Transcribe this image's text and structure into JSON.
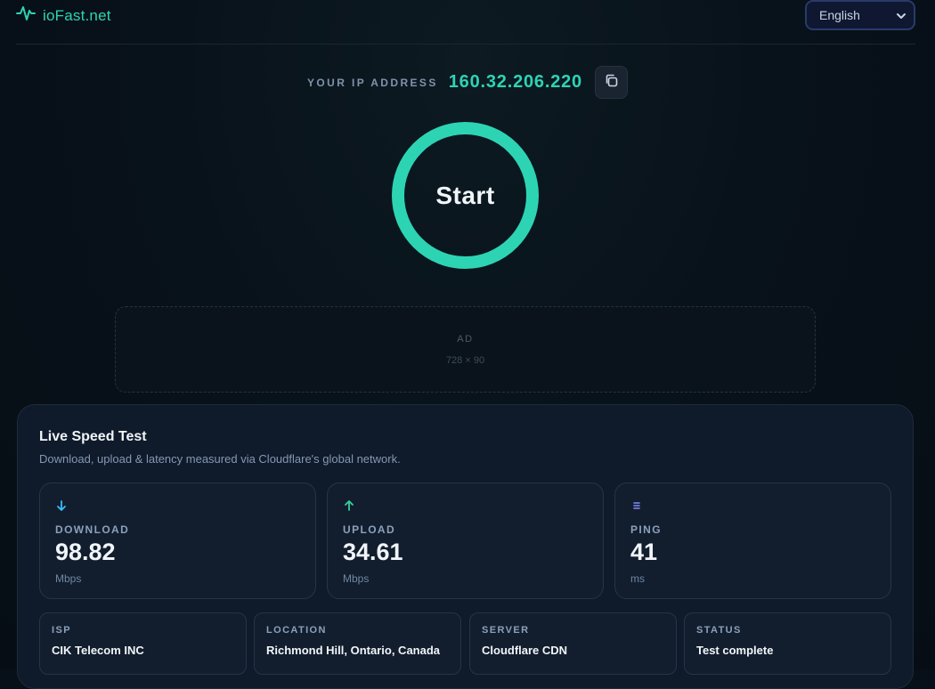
{
  "brand": {
    "name": "ioFast.net"
  },
  "language": {
    "selected": "English"
  },
  "ip": {
    "label": "YOUR IP ADDRESS",
    "value": "160.32.206.220"
  },
  "start_button": {
    "label": "Start"
  },
  "ad": {
    "label": "AD",
    "size": "728 × 90"
  },
  "panel": {
    "title": "Live Speed Test",
    "subtitle": "Download, upload & latency measured via Cloudflare's global network.",
    "metrics": [
      {
        "icon": "arrow-down-icon",
        "label": "DOWNLOAD",
        "value": "98.82",
        "unit": "Mbps",
        "color": "#38bdf8"
      },
      {
        "icon": "arrow-up-icon",
        "label": "UPLOAD",
        "value": "34.61",
        "unit": "Mbps",
        "color": "#34d399"
      },
      {
        "icon": "ping-icon",
        "label": "PING",
        "value": "41",
        "unit": "ms",
        "color": "#818cf8"
      }
    ],
    "info": [
      {
        "label": "ISP",
        "value": "CIK Telecom INC"
      },
      {
        "label": "LOCATION",
        "value": "Richmond Hill, Ontario, Canada"
      },
      {
        "label": "SERVER",
        "value": "Cloudflare CDN"
      },
      {
        "label": "STATUS",
        "value": "Test complete"
      }
    ]
  },
  "colors": {
    "accent": "#2dd4b4",
    "background": "#08121a",
    "panel": "#0f1a2a"
  }
}
